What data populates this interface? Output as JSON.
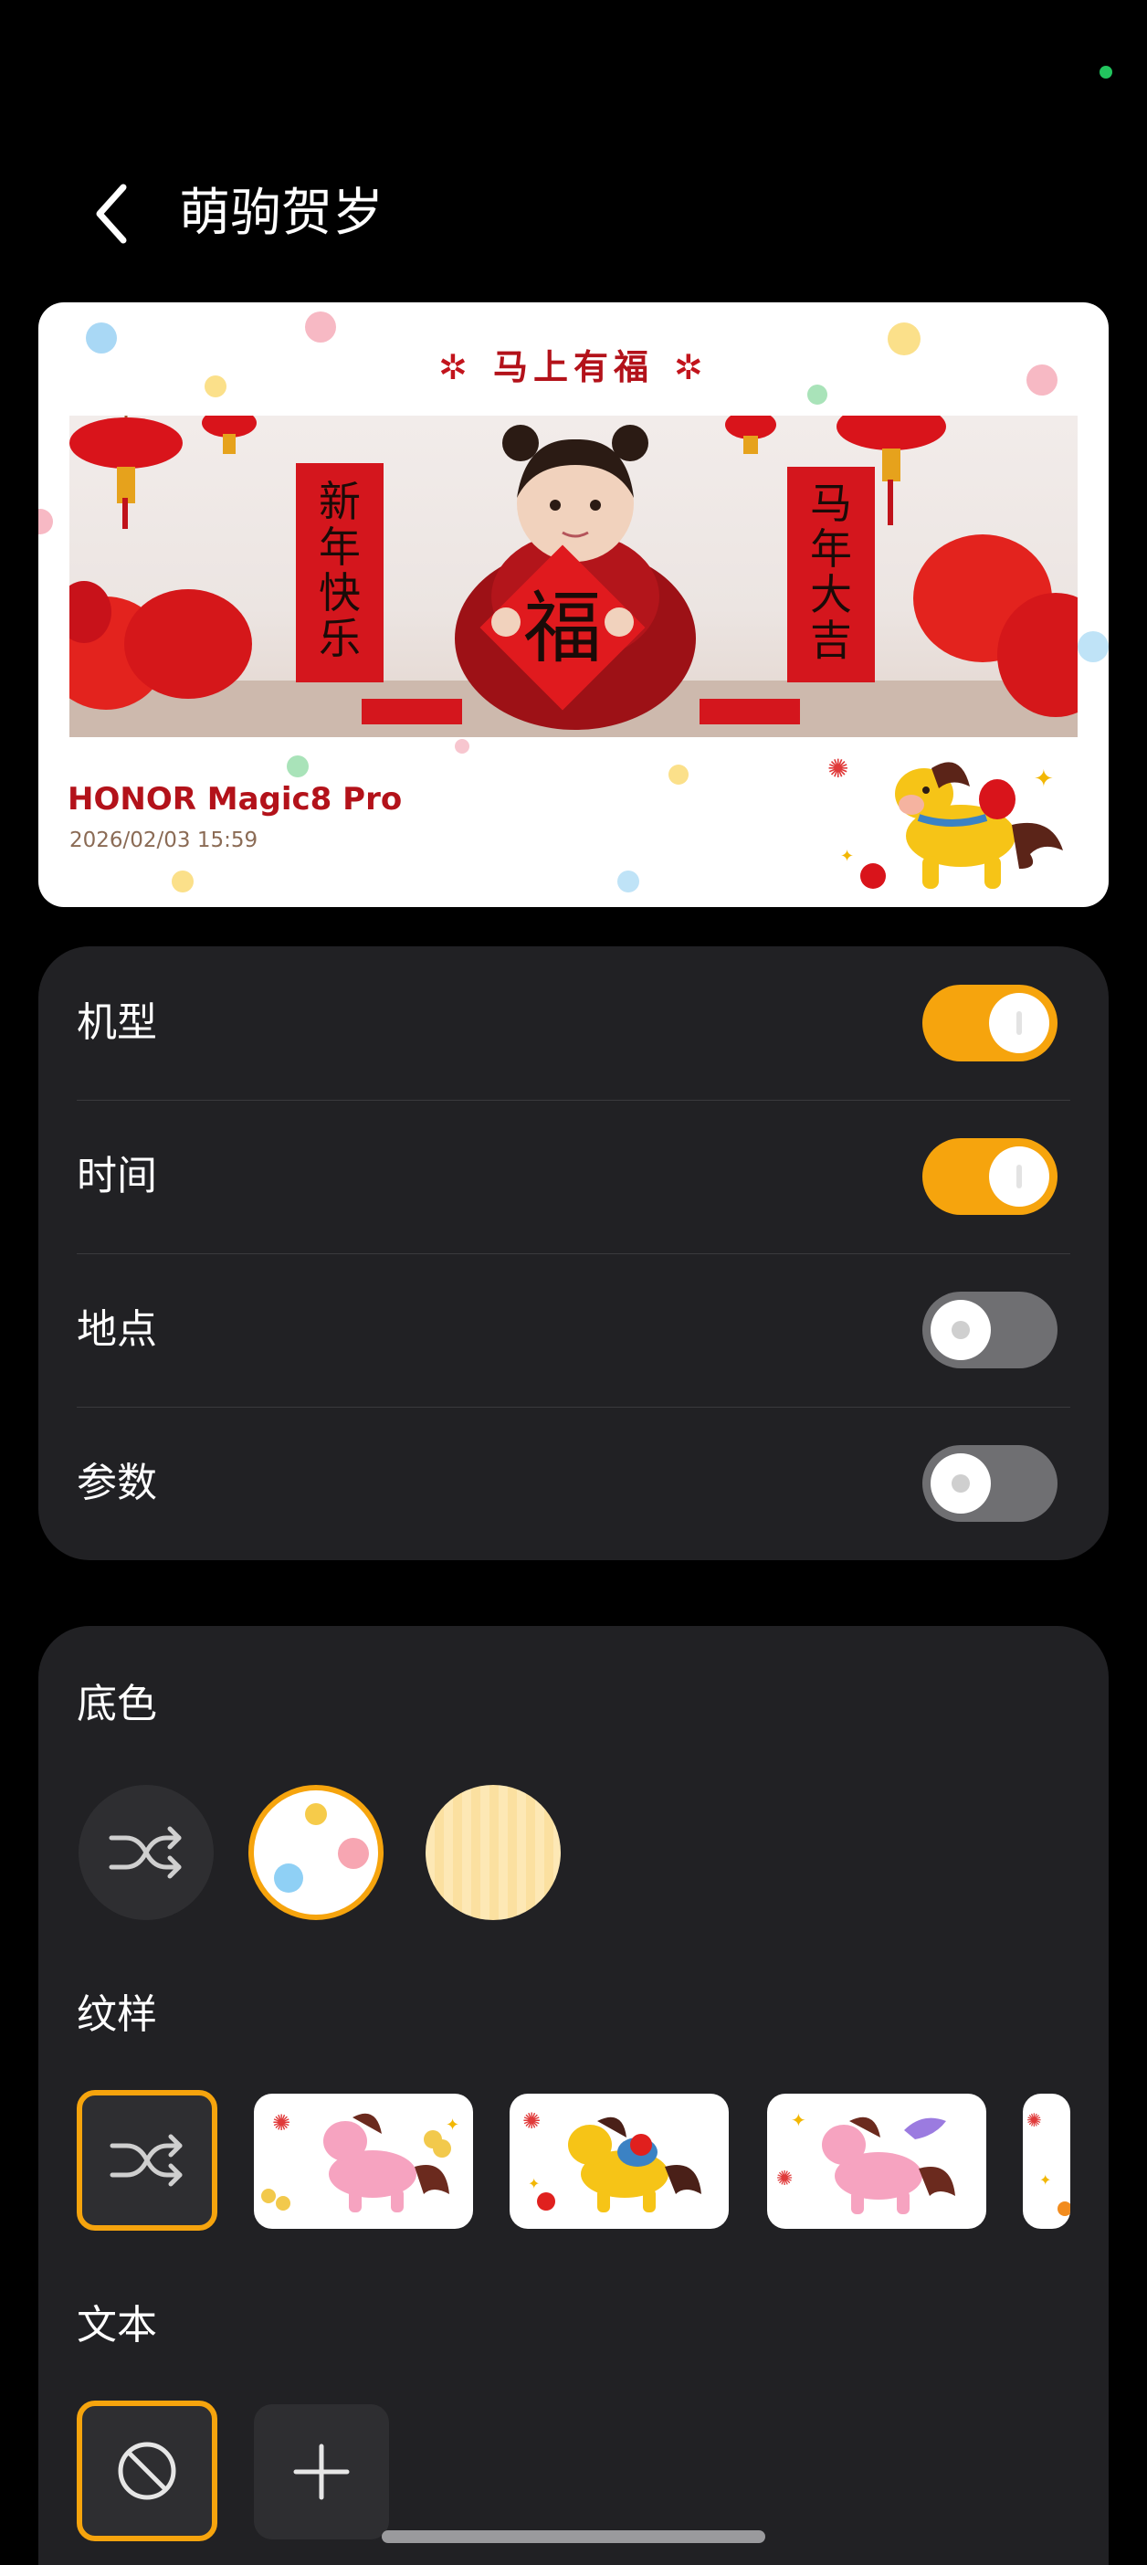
{
  "header": {
    "title": "萌驹贺岁"
  },
  "preview": {
    "banner_title": "马上有福",
    "device_name": "HONOR Magic8 Pro",
    "timestamp": "2026/02/03 15:59",
    "photo_texts": {
      "scroll_left": "新年快乐",
      "scroll_right": "马年大吉",
      "fu": "福"
    }
  },
  "toggles": [
    {
      "label": "机型",
      "on": true
    },
    {
      "label": "时间",
      "on": true
    },
    {
      "label": "地点",
      "on": false
    },
    {
      "label": "参数",
      "on": false
    }
  ],
  "options": {
    "background_label": "底色",
    "pattern_label": "纹样",
    "text_label": "文本"
  },
  "colors": {
    "accent": "#f6a40d",
    "card": "#212124",
    "brand_red": "#b3121a"
  }
}
